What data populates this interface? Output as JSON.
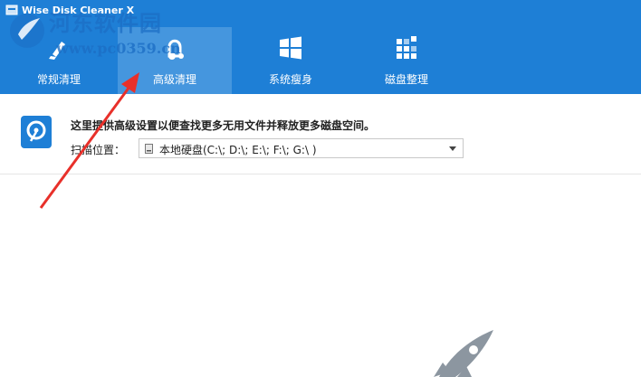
{
  "window": {
    "title": "Wise Disk Cleaner X"
  },
  "tabs": [
    {
      "label": "常规清理",
      "icon": "broom-icon"
    },
    {
      "label": "高级清理",
      "icon": "vacuum-cleaner-icon"
    },
    {
      "label": "系统瘦身",
      "icon": "windows-logo-icon"
    },
    {
      "label": "磁盘整理",
      "icon": "defrag-blocks-icon"
    }
  ],
  "active_tab": "高级清理",
  "watermark": {
    "text1": "河东软件园",
    "text2": "www.pc0359.cn"
  },
  "content": {
    "description": "这里提供高级设置以便查找更多无用文件并释放更多磁盘空间。",
    "scan_location_label": "扫描位置：",
    "scan_location_value": "本地硬盘(C:\\; D:\\; E:\\; F:\\; G:\\ )"
  },
  "colors": {
    "header": "#1e7fd6",
    "active_tab": "#4596de",
    "annotation_arrow": "#e8302a"
  }
}
